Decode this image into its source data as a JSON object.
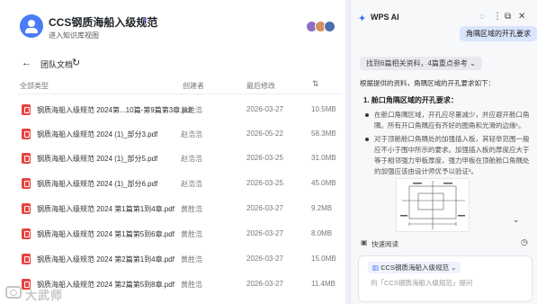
{
  "header": {
    "title": "CCS钢质海船入级规范",
    "badge_icon": "ai-sparkle-icon",
    "link": "进入知识库视图"
  },
  "breadcrumb": {
    "back_icon": "←",
    "label": "团队文档",
    "refresh_icon": "↻"
  },
  "table": {
    "headers": {
      "name": "全部类型",
      "creator": "创建者",
      "modified": "最后修改",
      "filter_icon": "⇅"
    },
    "rows": [
      {
        "name": "钢质海船入级规范 2024第...10篇-第9篇第3章.pdf",
        "creator": "黄胜浩",
        "date": "2026-03-27",
        "size": "10.5MB"
      },
      {
        "name": "钢质海船入级规范 2024 (1)_部分3.pdf",
        "creator": "赵浩浩",
        "date": "2026-05-22",
        "size": "58.3MB"
      },
      {
        "name": "钢质海船入级规范 2024 (1)_部分5.pdf",
        "creator": "赵浩浩",
        "date": "2026-03-25",
        "size": "31.0MB"
      },
      {
        "name": "钢质海船入级规范 2024 (1)_部分6.pdf",
        "creator": "赵浩浩",
        "date": "2026-03-25",
        "size": "45.0MB"
      },
      {
        "name": "钢质海船入级规范 2024 第1篇第1到4章.pdf",
        "creator": "黄胜浩",
        "date": "2026-03-27",
        "size": "9.2MB"
      },
      {
        "name": "钢质海船入级规范 2024 第1篇第5到6章.pdf",
        "creator": "黄胜浩",
        "date": "2026-03-27",
        "size": "8.0MB"
      },
      {
        "name": "钢质海船入级规范 2024 第2篇第1到4章.pdf",
        "creator": "黄胜浩",
        "date": "2026-03-27",
        "size": "15.0MB"
      },
      {
        "name": "钢质海船入级规范 2024 第2篇第5到8章.pdf",
        "creator": "黄胜浩",
        "date": "2026-03-27",
        "size": "11.4MB"
      }
    ]
  },
  "watermark": "大武师",
  "ai_panel": {
    "title": "WPS AI",
    "controls": [
      "◌",
      "⋮",
      "⧉",
      "✕"
    ],
    "user_question": "角隅区域的开孔要求",
    "sources_label": "找到6篇相关资料，4篇重点参考",
    "answer_intro": "根据提供的资料，角隅区域的开孔要求如下：",
    "section_heading": "1. 舱口角隅区域的开孔要求：",
    "bullet1_lines": [
      "在舱口角隅区域，开孔应尽量减少，并应避开舱口角",
      "隅。所有开口角隅应有齐好的图角和光滑的边缘¹。"
    ],
    "bullet2_lines": [
      "对于顶舱舱口角隅处的加强插入板，其轻举范围一般",
      "应不小于围中所示的要求。加强插入板的厚度应大于",
      "等于相邻强力甲板厚度，强力甲板在顶舱舱口角隅处",
      "的加强应该由设计师优予以验证²。"
    ],
    "quick_read": "快速阅读",
    "input": {
      "chip": "CCS钢质海船入级规范",
      "placeholder": "向「CCS钢质海船入级规范」提问"
    }
  },
  "colors": {
    "accent": "#4a7cf6",
    "pdf": "#e8433e",
    "bubble": "#d9e4fd"
  }
}
